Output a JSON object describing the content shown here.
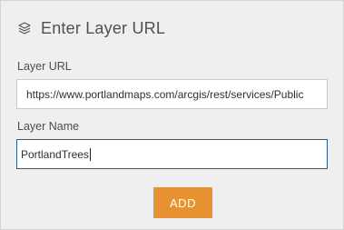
{
  "header": {
    "icon": "layers-icon",
    "title": "Enter Layer URL"
  },
  "form": {
    "url_label": "Layer URL",
    "url_value": "https://www.portlandmaps.com/arcgis/rest/services/Public",
    "name_label": "Layer Name",
    "name_value": "PortlandTrees"
  },
  "actions": {
    "add_label": "ADD"
  },
  "colors": {
    "accent": "#e69233",
    "panel_bg": "#efefef",
    "focus_border": "#2c5a8c"
  }
}
